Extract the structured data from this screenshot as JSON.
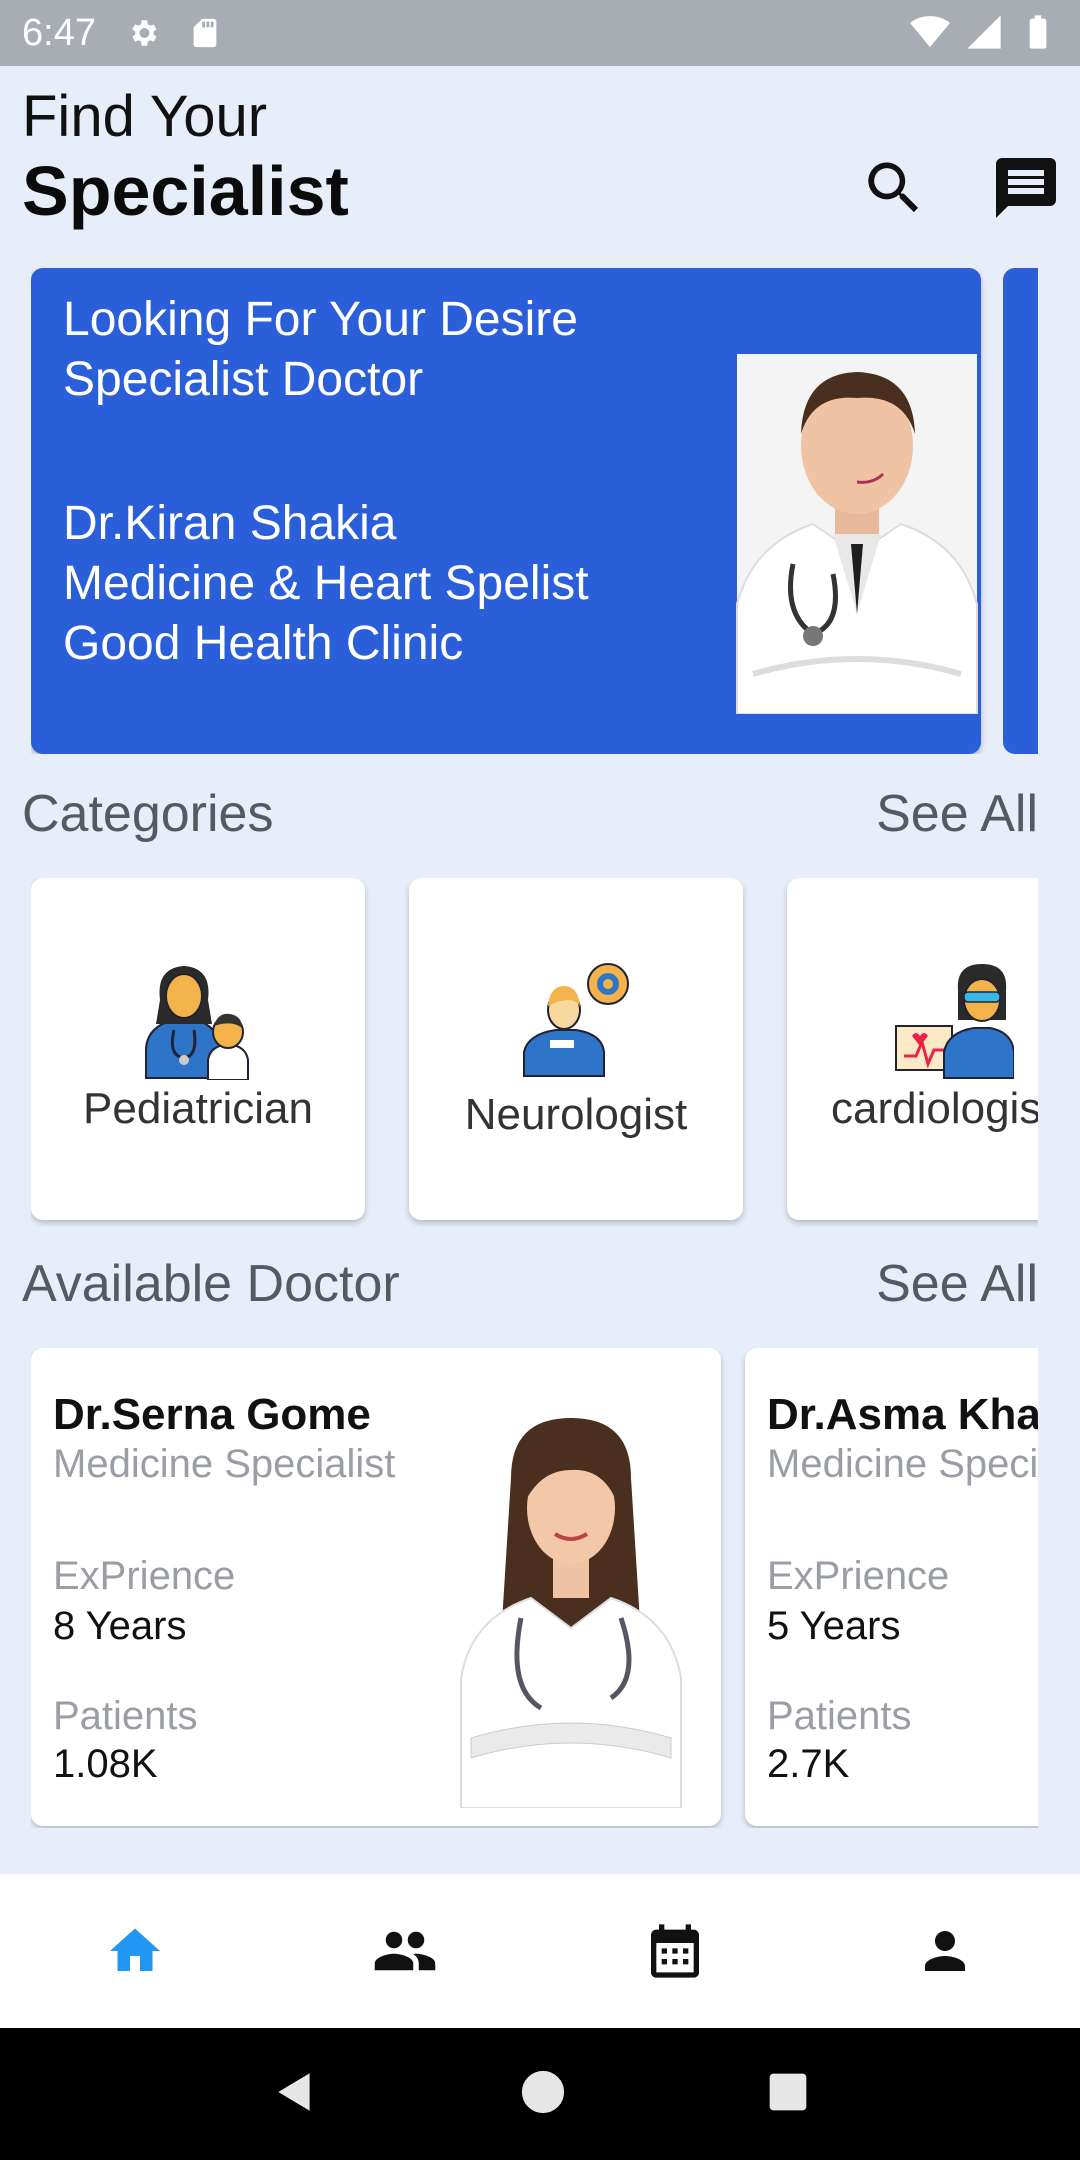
{
  "status_bar": {
    "time": "6:47"
  },
  "header": {
    "line1": "Find Your",
    "line2": "Specialist"
  },
  "banner": {
    "tagline": "Looking For Your Desire Specialist Doctor",
    "doctor_name": "Dr.Kiran Shakia",
    "specialty": "Medicine & Heart Spelist",
    "clinic": "Good Health Clinic"
  },
  "categories": {
    "title": "Categories",
    "see_all": "See All",
    "items": [
      {
        "label": "Pediatrician",
        "icon": "pediatrician-icon"
      },
      {
        "label": "Neurologist",
        "icon": "neurologist-icon"
      },
      {
        "label": "cardiologist",
        "icon": "cardiologist-icon"
      }
    ]
  },
  "doctors": {
    "title": "Available Doctor",
    "see_all": "See All",
    "items": [
      {
        "name": "Dr.Serna Gome",
        "specialty": "Medicine Specialist",
        "exp_label": "ExPrience",
        "exp_value": "8 Years",
        "patients_label": "Patients",
        "patients_value": "1.08K"
      },
      {
        "name": "Dr.Asma Khan",
        "specialty": "Medicine Specialist",
        "exp_label": "ExPrience",
        "exp_value": "5 Years",
        "patients_label": "Patients",
        "patients_value": "2.7K"
      }
    ]
  },
  "bottom_nav": {
    "items": [
      {
        "icon": "home-icon",
        "active": true
      },
      {
        "icon": "people-icon",
        "active": false
      },
      {
        "icon": "calendar-icon",
        "active": false
      },
      {
        "icon": "person-icon",
        "active": false
      }
    ]
  },
  "colors": {
    "accent": "#2b5fd9",
    "background": "#e8eef9",
    "active_nav": "#2196f3"
  }
}
